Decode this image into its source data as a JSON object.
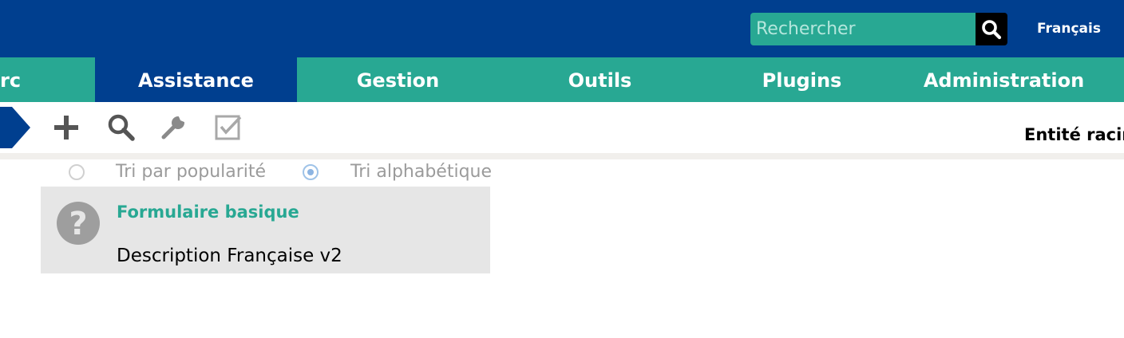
{
  "header": {
    "search": {
      "placeholder": "Rechercher",
      "value": ""
    },
    "language": "Français"
  },
  "menu": {
    "items": [
      {
        "label": "rc",
        "active": false
      },
      {
        "label": "Assistance",
        "active": true
      },
      {
        "label": "Gestion",
        "active": false
      },
      {
        "label": "Outils",
        "active": false
      },
      {
        "label": "Plugins",
        "active": false
      },
      {
        "label": "Administration",
        "active": false
      }
    ]
  },
  "toolbar": {
    "icons": [
      "add-icon",
      "search-icon",
      "wrench-icon",
      "checkbox-icon"
    ],
    "entity": "Entité racin"
  },
  "sort": {
    "options": [
      {
        "label": "Tri par popularité",
        "checked": false
      },
      {
        "label": "Tri alphabétique",
        "checked": true
      }
    ]
  },
  "forms": [
    {
      "title": "Formulaire basique",
      "description": "Description Française v2",
      "icon": "help-icon"
    }
  ],
  "colors": {
    "primary": "#003f8f",
    "accent": "#28a893",
    "card": "#e6e6e6"
  }
}
